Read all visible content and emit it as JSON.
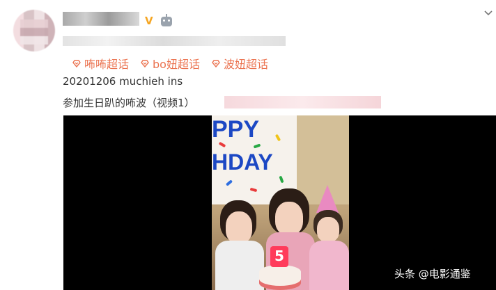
{
  "post": {
    "vip_badge": "V",
    "topics": [
      {
        "label": "咘咘超话",
        "icon": "topic-icon"
      },
      {
        "label": "bo妞超话",
        "icon": "topic-icon"
      },
      {
        "label": "波妞超话",
        "icon": "topic-icon"
      }
    ],
    "line1": "20201206 muchieh ins",
    "line2": "参加生日趴的咘波（视频1）"
  },
  "video": {
    "banner_line1": "PPY",
    "banner_line2": "HDAY",
    "candle_number": "5"
  },
  "watermark": "头条 @电影通鉴",
  "colors": {
    "topic": "#eb7350",
    "vip": "#f5a623",
    "text": "#333333",
    "video_bg": "#000000"
  },
  "icons": [
    "chevron-down-icon",
    "robot-icon",
    "topic-icon"
  ]
}
